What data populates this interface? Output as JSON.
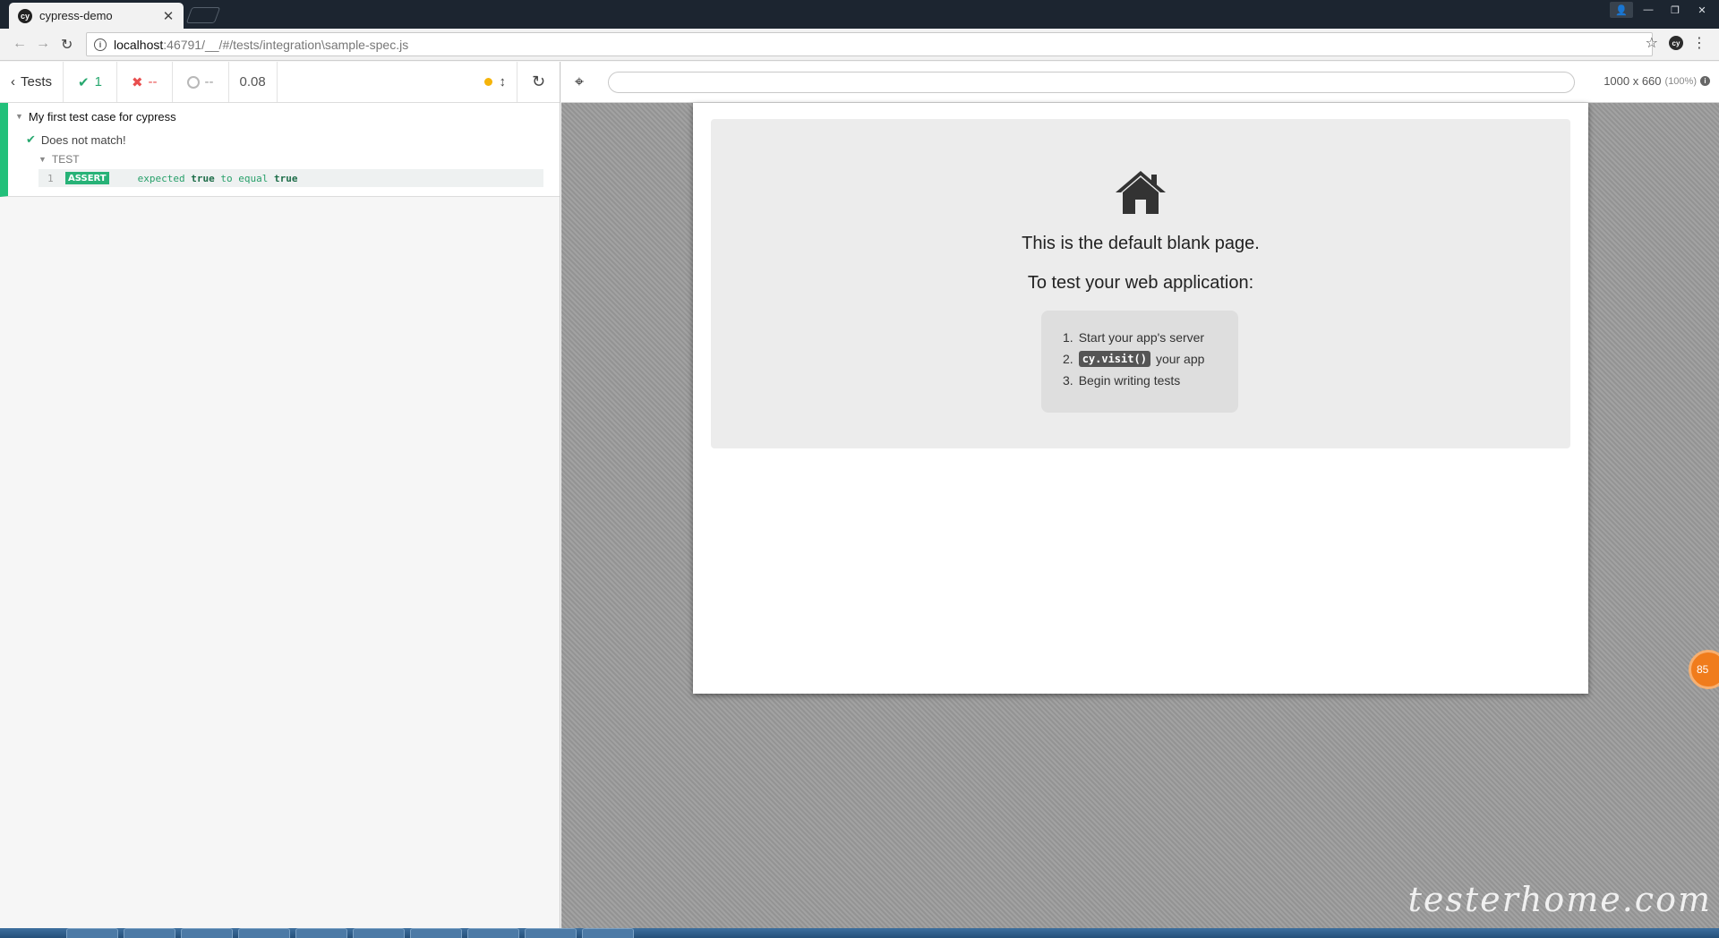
{
  "browser": {
    "tab_title": "cypress-demo",
    "tab_favicon": "cy",
    "url_host": "localhost",
    "url_rest": ":46791/__/#/tests/integration\\sample-spec.js"
  },
  "reporter": {
    "back_label": "Tests",
    "passed": "1",
    "failed": "--",
    "pending": "--",
    "duration": "0.08",
    "suite": {
      "title": "My first test case for cypress",
      "test": {
        "title": "Does not match!",
        "section": "TEST",
        "command": {
          "number": "1",
          "name": "ASSERT",
          "text_pre": "expected ",
          "val1": "true",
          "text_mid": " to equal ",
          "val2": "true"
        }
      }
    },
    "colors": {
      "pass": "#28a86f",
      "fail": "#e94f4f",
      "running": "#f5b40a"
    }
  },
  "aut": {
    "viewport_size": "1000 x 660",
    "viewport_scale": "(100%)",
    "blank_page": {
      "line1": "This is the default blank page.",
      "line2": "To test your web application:",
      "step1_num": "1.",
      "step1": "Start your app's server",
      "step2_num": "2.",
      "step2_code": "cy.visit()",
      "step2": "your app",
      "step3_num": "3.",
      "step3": "Begin writing tests"
    },
    "float_badge": "85",
    "watermark": "testerhome.com"
  }
}
